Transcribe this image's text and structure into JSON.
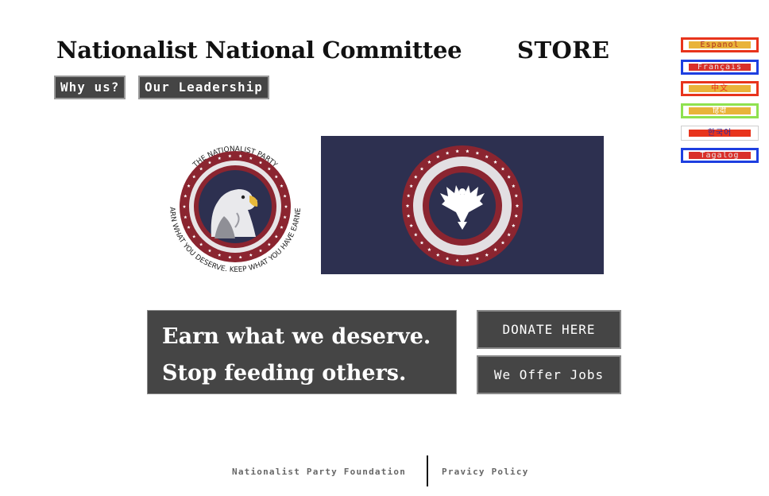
{
  "header": {
    "title": "Nationalist National Committee",
    "store_label": "STORE"
  },
  "nav": [
    {
      "label": "Why us?"
    },
    {
      "label": "Our Leadership"
    }
  ],
  "languages": [
    {
      "label": "Espanol",
      "border": "#e8341c",
      "bar": "#e9b33a",
      "text": "#b03020"
    },
    {
      "label": "Français",
      "border": "#1e3fe0",
      "bar": "#d9302a",
      "text": "#e6e6e6"
    },
    {
      "label": "中文",
      "border": "#e8341c",
      "bar": "#e9b33a",
      "text": "#e8341c"
    },
    {
      "label": "हिंदी",
      "border": "#8fe14f",
      "bar": "#e9b33a",
      "text": "#ffffff"
    },
    {
      "label": "한국어",
      "border": "#cfcfcf",
      "bar": "#e8341c",
      "text": "#2a2aa0"
    },
    {
      "label": "Tagalog",
      "border": "#1e3fe0",
      "bar": "#d9302a",
      "text": "#e6e6e6"
    }
  ],
  "seal": {
    "top_text": "THE NATIONALIST PARTY",
    "bottom_text": "EARN WHAT YOU DESERVE. KEEP WHAT YOU HAVE EARNED",
    "ring_color": "#8b2530",
    "inner_color": "#2d3050"
  },
  "flag": {
    "background": "#2d3050",
    "ring_color": "#8b2530"
  },
  "slogan": {
    "line1": "Earn what we deserve.",
    "line2": "Stop feeding others."
  },
  "actions": {
    "donate_label": "DONATE HERE",
    "jobs_label": "We Offer Jobs"
  },
  "footer": {
    "foundation_label": "Nationalist Party Foundation",
    "privacy_label": "Pravicy Policy"
  }
}
